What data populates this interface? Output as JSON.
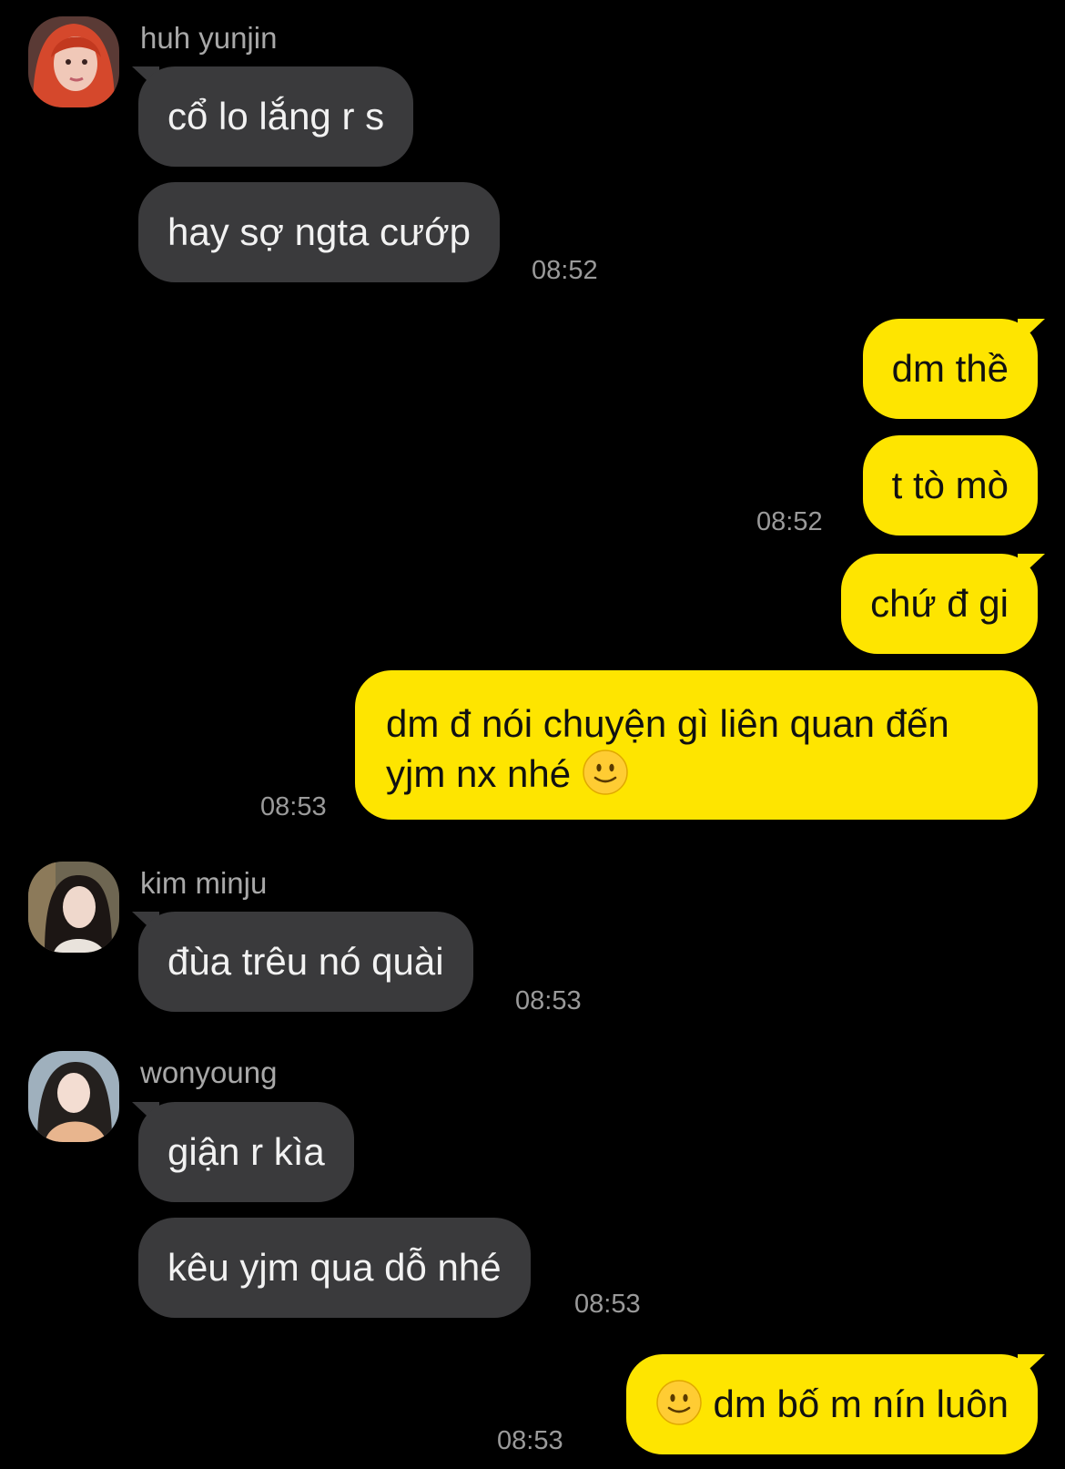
{
  "messages": [
    {
      "sender": "huh yunjin",
      "bubbles": [
        "cổ lo lắng r s",
        "hay sợ ngta cướp"
      ],
      "time": "08:52"
    },
    {
      "sender": "me",
      "bubbles": [
        "dm thề",
        "t tò mò"
      ],
      "time": "08:52"
    },
    {
      "sender": "me",
      "bubbles": [
        "chứ đ gi",
        "dm đ nói chuyện gì liên quan đến",
        "yjm nx nhé"
      ],
      "time": "08:53"
    },
    {
      "sender": "kim minju",
      "bubbles": [
        "đùa trêu nó quài"
      ],
      "time": "08:53"
    },
    {
      "sender": "wonyoung",
      "bubbles": [
        "giận r kìa",
        "kêu yjm qua dỗ nhé"
      ],
      "time": "08:53"
    },
    {
      "sender": "me",
      "bubbles": [
        "dm bố m nín luôn"
      ],
      "time": "08:53"
    }
  ],
  "colors": {
    "background": "#000000",
    "incoming_bubble": "#3a3a3c",
    "outgoing_bubble": "#fee500",
    "time": "#9a9a9a"
  },
  "icons": {
    "emoji": "slightly-smiling-face"
  }
}
